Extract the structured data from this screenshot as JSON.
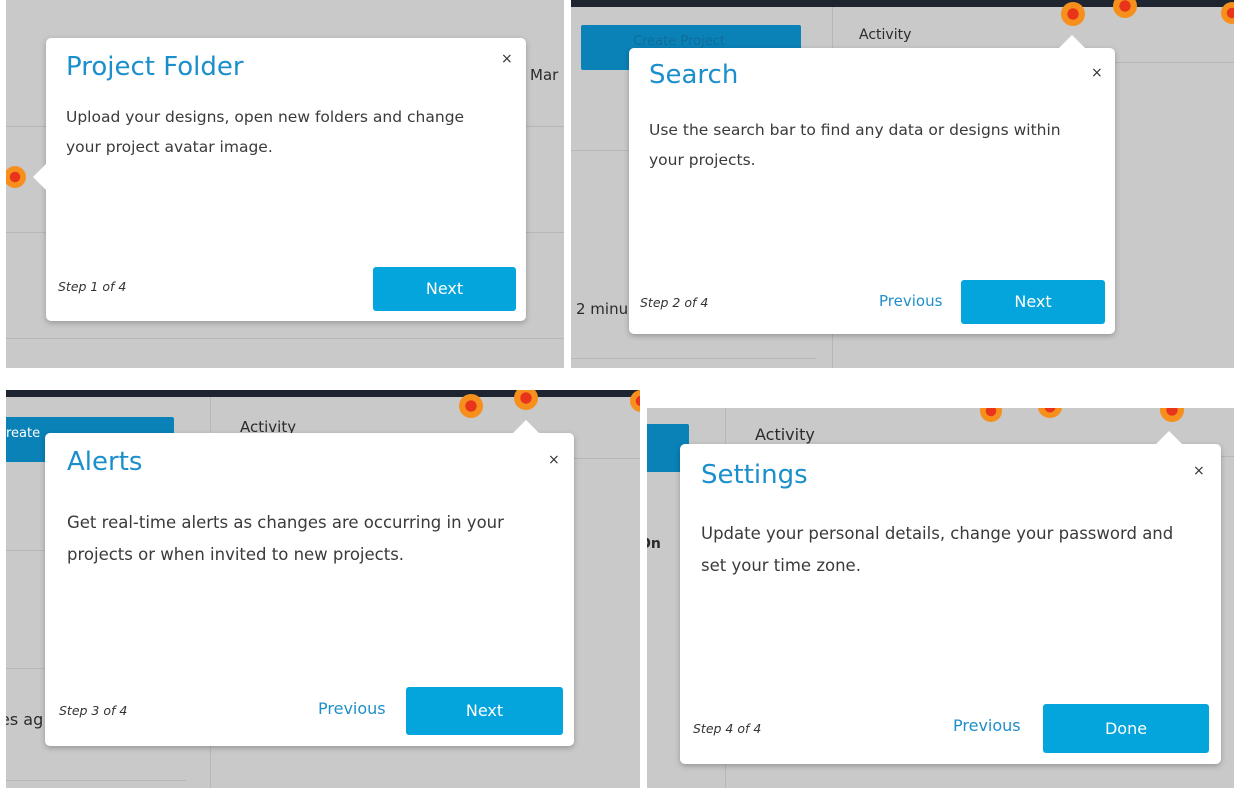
{
  "panels": [
    {
      "background_fragments": [
        "Mar"
      ],
      "tooltip": {
        "title": "Project Folder",
        "body": "Upload your designs, open new folders and change your project avatar image.",
        "step": "Step 1 of 4",
        "primary_label": "Next",
        "close": "×"
      }
    },
    {
      "background_fragments": [
        "Create Project",
        "Activity",
        "2 minu"
      ],
      "tooltip": {
        "title": "Search",
        "body": "Use the search bar to find any data or designs within your projects.",
        "step": "Step 2 of 4",
        "previous_label": "Previous",
        "primary_label": "Next",
        "close": "×"
      }
    },
    {
      "background_fragments": [
        "reate",
        "Activity",
        "es ag"
      ],
      "tooltip": {
        "title": "Alerts",
        "body": "Get real-time alerts as changes are occurring in your projects or when invited to new projects.",
        "step": "Step 3 of 4",
        "previous_label": "Previous",
        "primary_label": "Next",
        "close": "×"
      }
    },
    {
      "background_fragments": [
        "Activity",
        "On"
      ],
      "tooltip": {
        "title": "Settings",
        "body": "Update your personal details, change your password and set your time zone.",
        "step": "Step 4 of 4",
        "previous_label": "Previous",
        "primary_label": "Done",
        "close": "×"
      }
    }
  ],
  "colors": {
    "overlay": "#c9c9c9",
    "tooltip_bg": "#ffffff",
    "title": "#1b8fcc",
    "primary_button": "#04a4dc",
    "hotspot_outer": "#f78f1c",
    "hotspot_inner": "#e8341b",
    "header_bar": "#1f2431"
  },
  "icons": {
    "close": "close-icon",
    "hotspot": "hotspot-beacon-icon"
  }
}
